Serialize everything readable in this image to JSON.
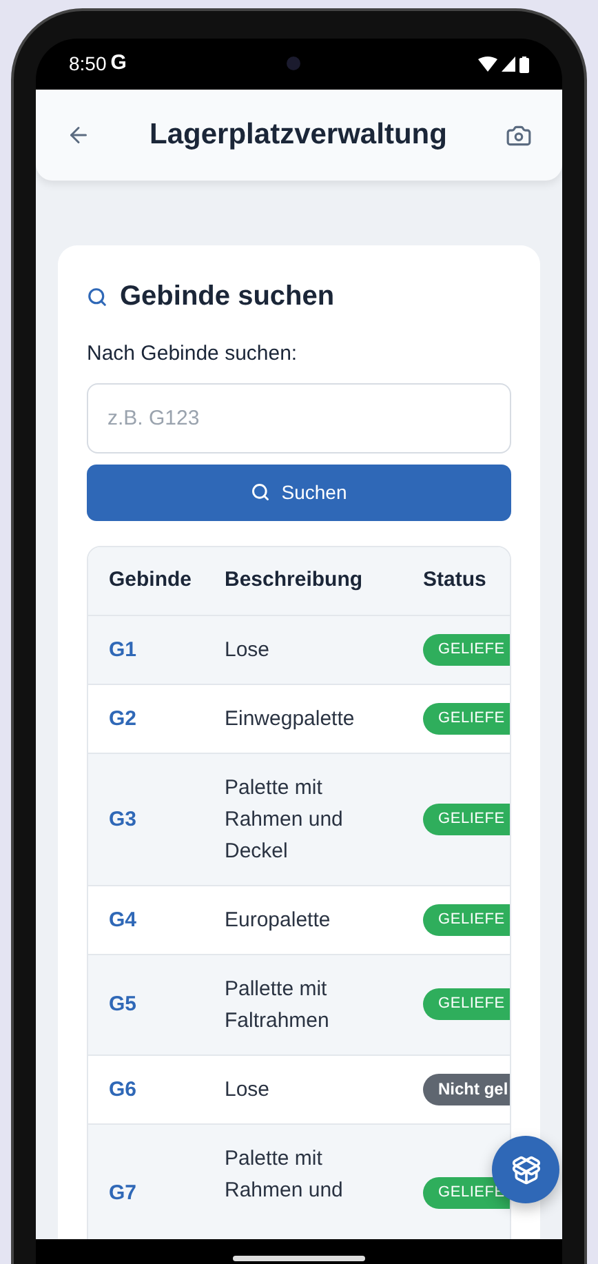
{
  "status_bar": {
    "time": "8:50",
    "carrier": "G"
  },
  "app_bar": {
    "title": "Lagerplatzverwaltung"
  },
  "search_card": {
    "title": "Gebinde suchen",
    "label": "Nach Gebinde suchen:",
    "field": {
      "placeholder": "z.B. G123"
    },
    "button": "Suchen"
  },
  "table": {
    "columns": [
      "Gebinde",
      "Beschreibung",
      "Status"
    ],
    "rows": [
      {
        "id": "G1",
        "description": [
          "Lose"
        ],
        "status": {
          "label": "GELIEFE",
          "kind": "delivered"
        }
      },
      {
        "id": "G2",
        "description": [
          "Einwegpalette"
        ],
        "status": {
          "label": "GELIEFE",
          "kind": "delivered"
        }
      },
      {
        "id": "G3",
        "description": [
          "Palette mit",
          "Rahmen und",
          "Deckel"
        ],
        "status": {
          "label": "GELIEFE",
          "kind": "delivered"
        }
      },
      {
        "id": "G4",
        "description": [
          "Europalette"
        ],
        "status": {
          "label": "GELIEFE",
          "kind": "delivered"
        }
      },
      {
        "id": "G5",
        "description": [
          "Pallette mit",
          "Faltrahmen"
        ],
        "status": {
          "label": "GELIEFE",
          "kind": "delivered"
        }
      },
      {
        "id": "G6",
        "description": [
          "Lose"
        ],
        "status": {
          "label": "Nicht gel",
          "kind": "not_delivered"
        }
      },
      {
        "id": "G7",
        "description": [
          "Palette mit",
          "Rahmen und"
        ],
        "status": {
          "label": "GELIEFE",
          "kind": "delivered"
        }
      }
    ]
  }
}
